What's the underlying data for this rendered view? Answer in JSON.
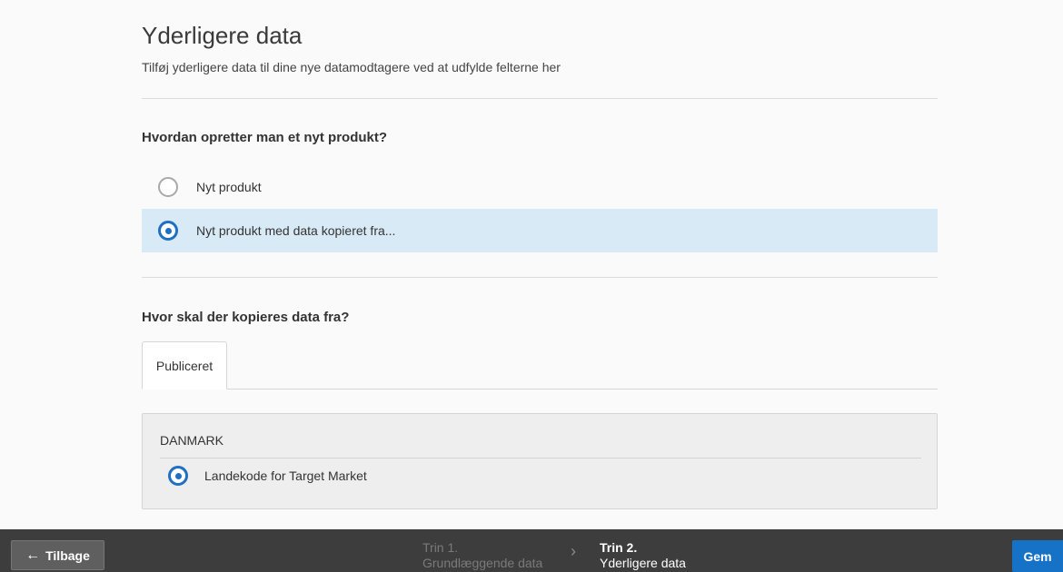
{
  "header": {
    "title": "Yderligere data",
    "subtitle": "Tilføj yderligere data til dine nye datamodtagere ved at udfylde felterne her"
  },
  "create_section": {
    "heading": "Hvordan opretter man et nyt produkt?",
    "options": [
      {
        "label": "Nyt produkt",
        "selected": false
      },
      {
        "label": "Nyt produkt med data kopieret fra...",
        "selected": true
      }
    ]
  },
  "copy_section": {
    "heading": "Hvor skal der kopieres data fra?",
    "tabs": [
      {
        "label": "Publiceret",
        "active": true
      }
    ],
    "panel": {
      "heading": "DANMARK",
      "options": [
        {
          "label": "Landekode for Target Market",
          "selected": true
        }
      ]
    }
  },
  "footer": {
    "back_label": "Tilbage",
    "steps": [
      {
        "number": "Trin 1.",
        "name": "Grundlæggende data",
        "active": false
      },
      {
        "number": "Trin 2.",
        "name": "Yderligere data",
        "active": true
      }
    ],
    "save_label": "Gem"
  },
  "colors": {
    "accent": "#1672c7",
    "selected_row_bg": "#d9eaf7",
    "footer_bg": "#3d3d3d"
  },
  "icons": {
    "back": "arrow-left-icon",
    "step_separator": "chevron-right-icon"
  }
}
